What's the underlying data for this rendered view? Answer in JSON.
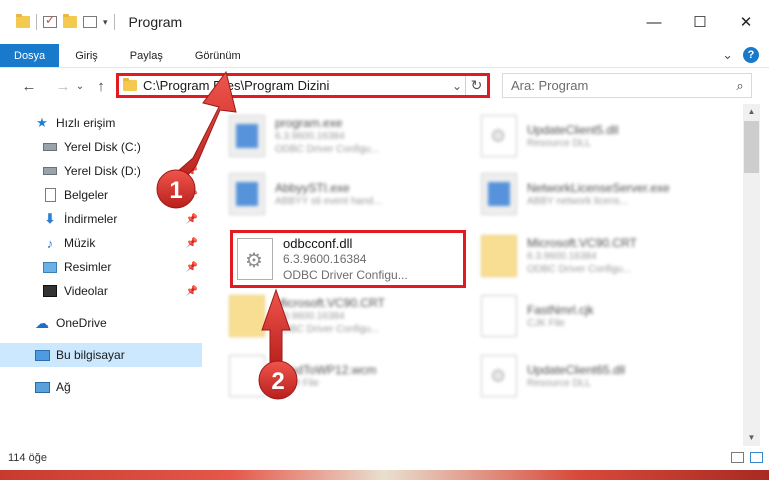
{
  "window": {
    "title": "Program",
    "controls": {
      "minimize": "—",
      "maximize": "☐",
      "close": "✕"
    }
  },
  "ribbon": {
    "tabs": [
      "Dosya",
      "Giriş",
      "Paylaş",
      "Görünüm"
    ],
    "collapse": "⌄",
    "help": "?"
  },
  "nav": {
    "back": "←",
    "forward": "→",
    "recent": "⌄",
    "up": "↑",
    "address": "C:\\Program Files\\Program Dizini",
    "address_dropdown": "⌄",
    "refresh": "↻",
    "search_placeholder": "Ara: Program",
    "search_icon": "⌕"
  },
  "sidebar": {
    "items": [
      {
        "label": "Hızlı erişim",
        "icon": "star-icon",
        "pinned": false
      },
      {
        "label": "Yerel Disk (C:)",
        "icon": "drive-icon",
        "pinned": true
      },
      {
        "label": "Yerel Disk (D:)",
        "icon": "drive-icon",
        "pinned": true
      },
      {
        "label": "Belgeler",
        "icon": "document-icon",
        "pinned": true
      },
      {
        "label": "İndirmeler",
        "icon": "download-icon",
        "pinned": true
      },
      {
        "label": "Müzik",
        "icon": "music-icon",
        "pinned": true
      },
      {
        "label": "Resimler",
        "icon": "pictures-icon",
        "pinned": true
      },
      {
        "label": "Videolar",
        "icon": "videos-icon",
        "pinned": true
      },
      {
        "label": "OneDrive",
        "icon": "cloud-icon",
        "pinned": false
      },
      {
        "label": "Bu bilgisayar",
        "icon": "computer-icon",
        "pinned": false,
        "selected": true
      },
      {
        "label": "Ağ",
        "icon": "network-icon",
        "pinned": false
      }
    ],
    "pin_glyph": "📌"
  },
  "files": [
    {
      "name": "program.exe",
      "line1": "6.3.9600.16384",
      "line2": "ODBC Driver Configu...",
      "type": "exe"
    },
    {
      "name": "UpdateClient5.dll",
      "line1": "Resource DLL",
      "line2": "",
      "type": "dll"
    },
    {
      "name": "AbbyySTI.exe",
      "line1": "ABBYY sti event hand...",
      "line2": "",
      "type": "exe"
    },
    {
      "name": "NetworkLicenseServer.exe",
      "line1": "ABBY network licens...",
      "line2": "",
      "type": "exe"
    },
    {
      "name": "Microsoft.VC90.CRT",
      "line1": "6.3.9600.16384",
      "line2": "ODBC Driver Configu...",
      "type": "folder"
    },
    {
      "name": "Microsoft.VC90.CRT",
      "line1": "6.3.9600.16384",
      "line2": "ODBC Driver Configu...",
      "type": "folder"
    },
    {
      "name": "FastNmrl.cjk",
      "line1": "CJK File",
      "line2": "",
      "type": "plain"
    },
    {
      "name": "SendToWP12.wcm",
      "line1": "WCM File",
      "line2": "",
      "type": "plain"
    },
    {
      "name": "UpdateClient65.dll",
      "line1": "Resource DLL",
      "line2": "",
      "type": "dll"
    }
  ],
  "selected_file": {
    "name": "odbcconf.dll",
    "line1": "6.3.9600.16384",
    "line2": "ODBC Driver Configu..."
  },
  "status": {
    "count": "114 öğe"
  },
  "annotations": {
    "step1": "1",
    "step2": "2",
    "color": "#e11b22"
  }
}
